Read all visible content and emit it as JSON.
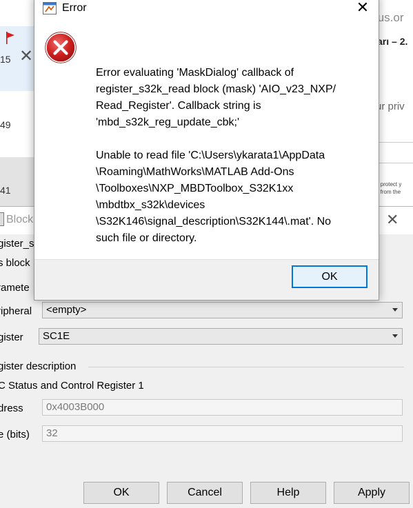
{
  "background_app": {
    "numbers": [
      "15",
      "49",
      "41"
    ]
  },
  "background_web": {
    "domain_fragment": "tus.or",
    "heading_fragment": "arı – 2.",
    "text_fragment": "ur priv",
    "small_text_1": "o protect y",
    "small_text_2": "e from the"
  },
  "block_params": {
    "title": "Block",
    "block_name": "gister_s",
    "description": "s block",
    "parameters_label": "ramete",
    "peripheral_label": "ripheral",
    "peripheral_value": "<empty>",
    "register_label": "gister",
    "register_value": "SC1E",
    "register_description_label": "gister description",
    "register_description_value": "C Status and Control Register 1",
    "address_label": "dress",
    "address_value": "0x4003B000",
    "size_label": "e (bits)",
    "size_value": "32",
    "buttons": {
      "ok": "OK",
      "cancel": "Cancel",
      "help": "Help",
      "apply": "Apply"
    }
  },
  "error_dialog": {
    "title": "Error",
    "message_lines": [
      "Error evaluating 'MaskDialog' callback of",
      "register_s32k_read block (mask) 'AIO_v23_NXP/",
      "Read_Register'. Callback string is",
      "'mbd_s32k_reg_update_cbk;'",
      "",
      "Unable to read file 'C:\\Users\\ykarata1\\AppData",
      "\\Roaming\\MathWorks\\MATLAB Add-Ons",
      "\\Toolboxes\\NXP_MBDToolbox_S32K1xx",
      "\\mbdtbx_s32k\\devices",
      "\\S32K146\\signal_description\\S32K144\\.mat'. No",
      "such file or directory."
    ],
    "ok_label": "OK",
    "colors": {
      "error_icon": "#cc1f1f",
      "ok_border": "#0078d7"
    }
  }
}
